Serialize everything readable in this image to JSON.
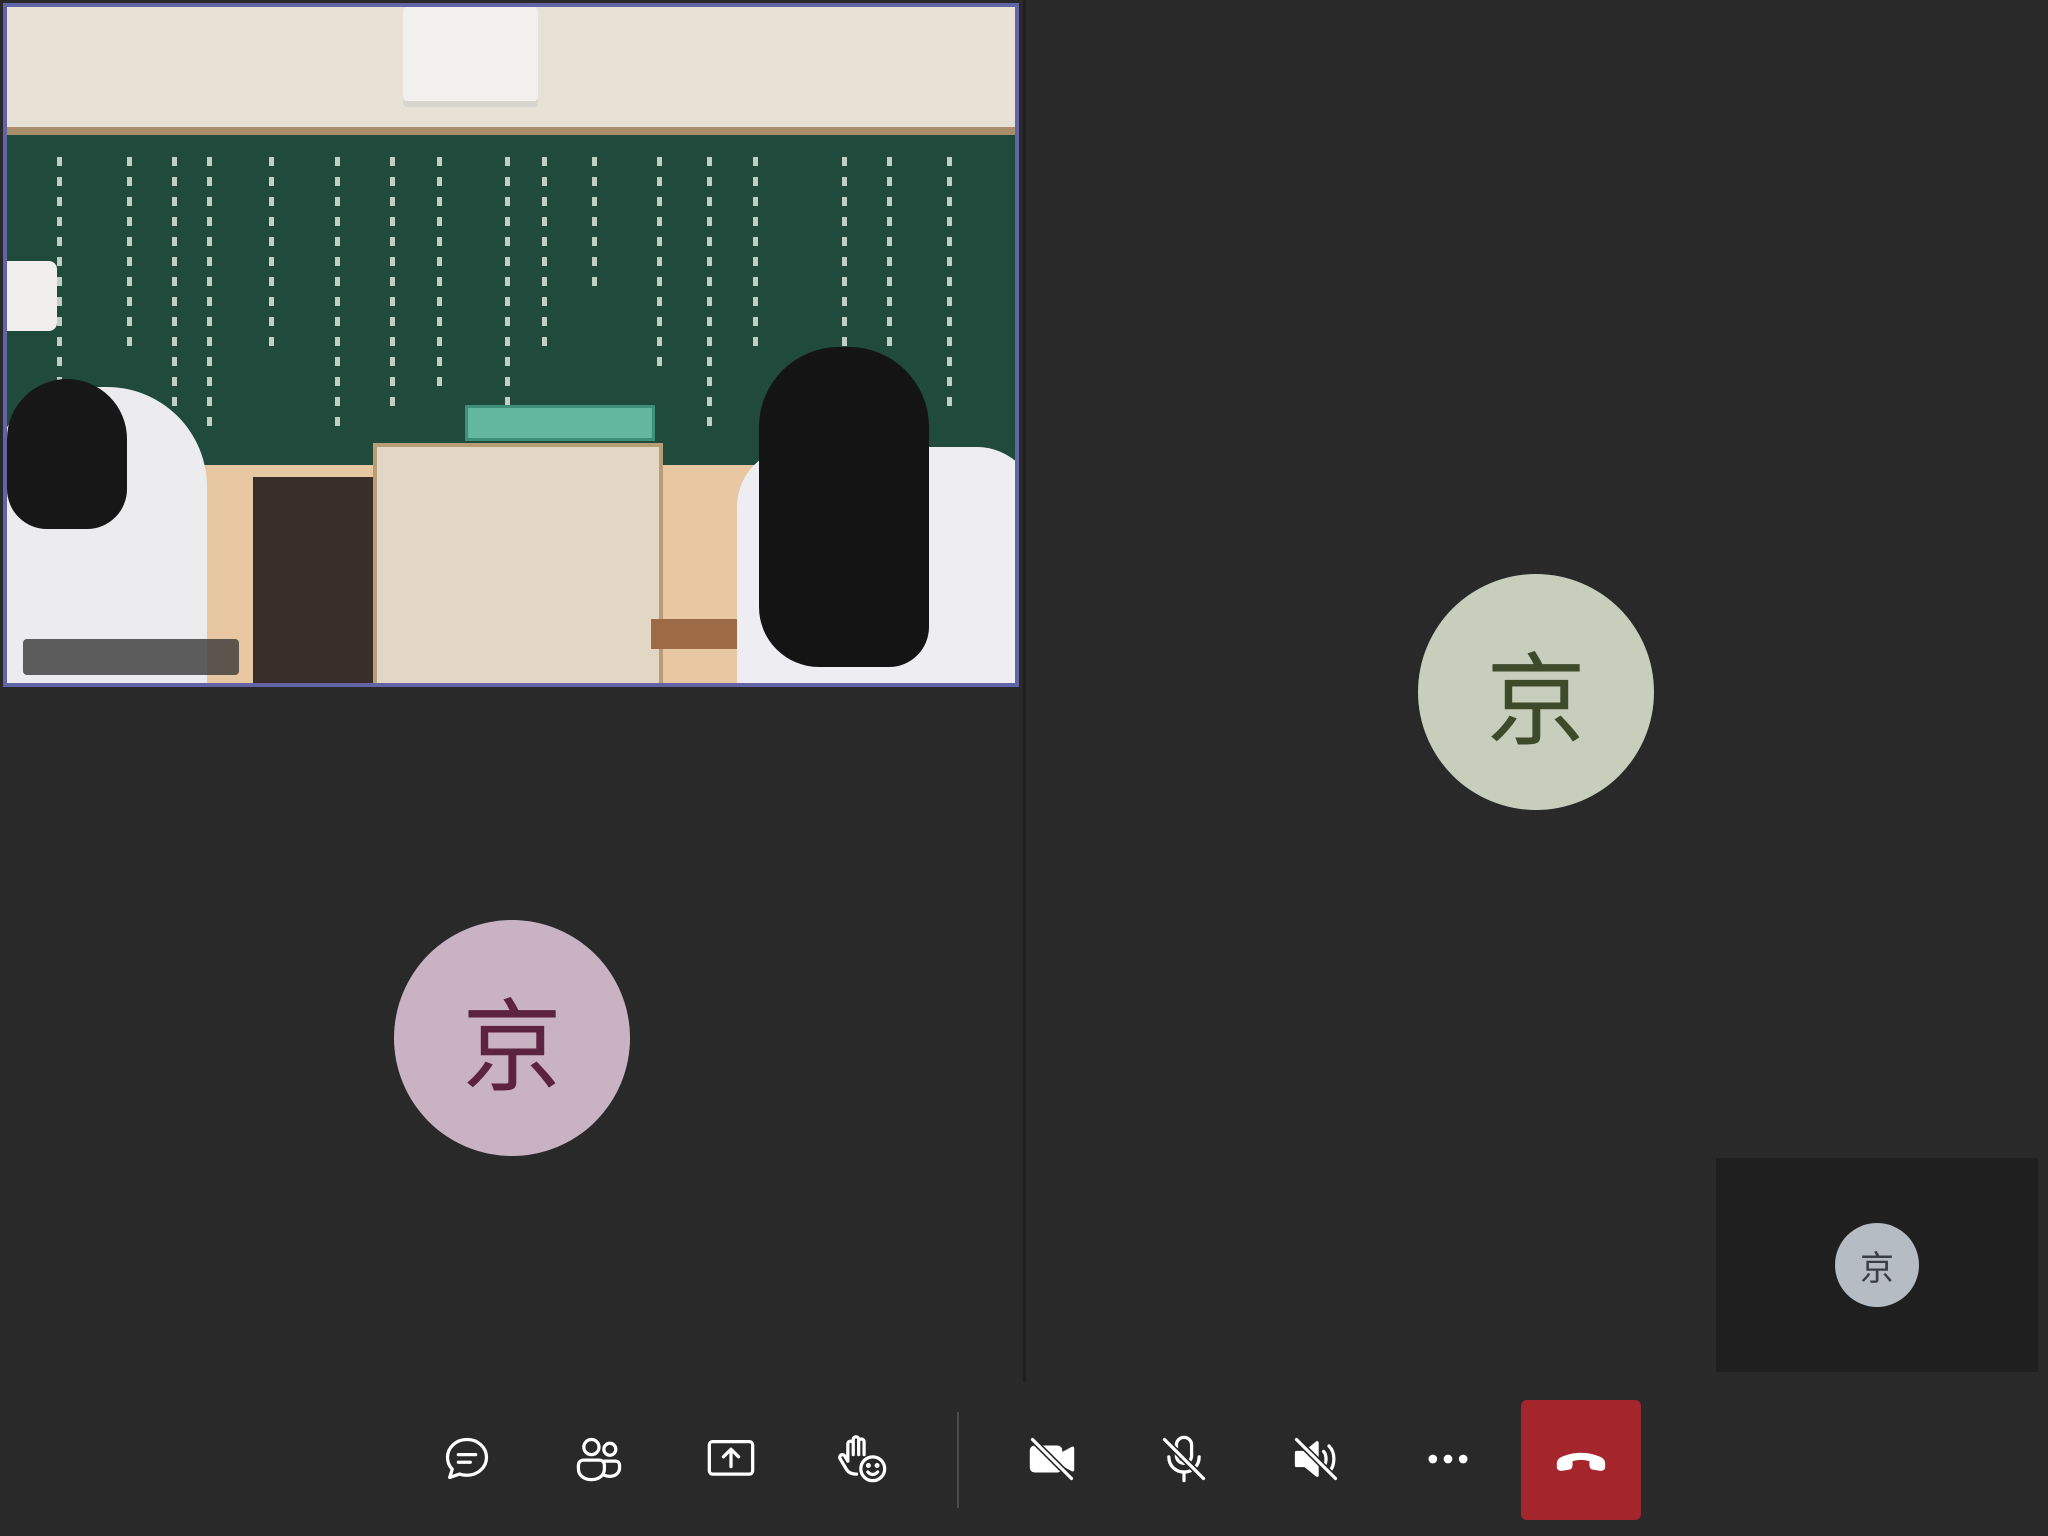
{
  "participants": {
    "left": {
      "initial": "京",
      "avatar_bg": "#c9b3c2",
      "avatar_fg": "#5c2240"
    },
    "right": {
      "initial": "京",
      "avatar_bg": "#c8cebc",
      "avatar_fg": "#3e4b2a"
    },
    "self": {
      "initial": "京",
      "avatar_bg": "#b6bcc4",
      "avatar_fg": "#3a3f47"
    }
  },
  "video_feed": {
    "highlight_color": "#6264a7",
    "content": "classroom-camera"
  },
  "controls": {
    "items": [
      {
        "name": "chat-button",
        "icon": "chat-icon"
      },
      {
        "name": "participants-button",
        "icon": "people-icon"
      },
      {
        "name": "share-screen-button",
        "icon": "share-tray-icon"
      },
      {
        "name": "reactions-button",
        "icon": "raise-hand-emoji-icon"
      },
      {
        "name": "camera-toggle-button",
        "icon": "video-off-icon"
      },
      {
        "name": "mic-toggle-button",
        "icon": "mic-off-icon"
      },
      {
        "name": "speaker-toggle-button",
        "icon": "speaker-off-icon"
      },
      {
        "name": "more-options-button",
        "icon": "ellipsis-icon"
      }
    ],
    "hangup": {
      "icon": "phone-hangup-icon",
      "bg": "#a4262c"
    }
  },
  "colors": {
    "stage_bg": "#1f1f1f",
    "tile_bg": "#292929",
    "control_bar_bg": "#292929",
    "icon_color": "#ffffff"
  }
}
